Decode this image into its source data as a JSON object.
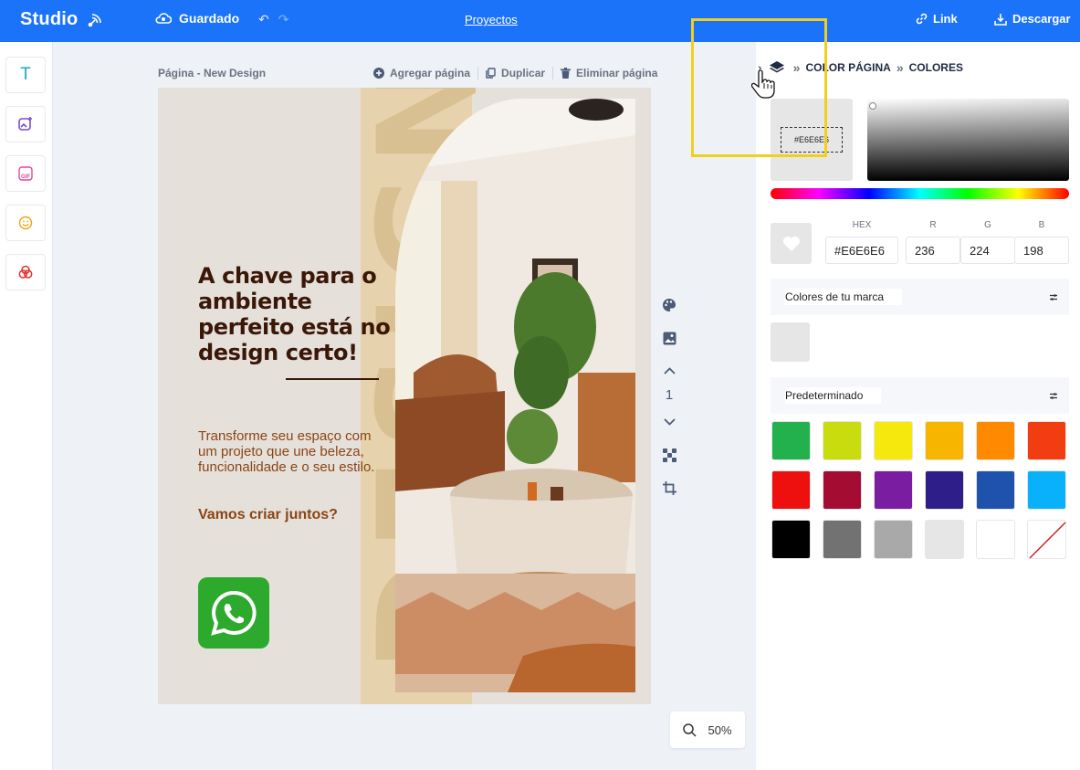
{
  "topbar": {
    "logo": "Studio",
    "saved": "Guardado",
    "projects": "Proyectos",
    "link": "Link",
    "download": "Descargar"
  },
  "left_tools": [
    {
      "name": "text-tool",
      "icon": "T",
      "color": "#1fa6c9"
    },
    {
      "name": "image-tool",
      "icon": "image-plus-icon",
      "color": "#7a4dd1"
    },
    {
      "name": "gif-tool",
      "icon": "gif-icon",
      "color": "#e8449c"
    },
    {
      "name": "emoji-tool",
      "icon": "emoji-icon",
      "color": "#e6a817"
    },
    {
      "name": "shapes-tool",
      "icon": "circles-icon",
      "color": "#e0342b"
    }
  ],
  "page": {
    "title": "Página - New Design",
    "add_page": "Agregar página",
    "duplicate": "Duplicar",
    "delete_page": "Eliminar página",
    "number": "1",
    "zoom": "50%"
  },
  "design": {
    "headline": "A chave para o ambiente perfeito está no design certo!",
    "body": "Transforme seu espaço com um projeto que une beleza, funcionalidade e o seu estilo.",
    "cta": "Vamos criar juntos?",
    "vertical_word": "DESIGN"
  },
  "panel": {
    "breadcrumb": [
      "COLOR PÁGINA",
      "COLORES"
    ],
    "selected_hex_label": "#E6E6E6",
    "hex_label": "HEX",
    "r_label": "R",
    "g_label": "G",
    "b_label": "B",
    "hex_value": "#E6E6E6",
    "r_value": "236",
    "g_value": "224",
    "b_value": "198",
    "brand_colors_title": "Colores de tu marca",
    "brand_colors": [
      "#e6e6e6"
    ],
    "default_title": "Predeterminado",
    "default_colors": [
      "#22b14c",
      "#c8dc0e",
      "#f4e80c",
      "#f7b500",
      "#ff8a00",
      "#f23d11",
      "#ee0f0f",
      "#a50c32",
      "#7b1da0",
      "#2e1e8a",
      "#1f52ad",
      "#09b1fb",
      "#000000",
      "#727272",
      "#a9a9a9",
      "#e6e6e6",
      "#ffffff",
      "none"
    ]
  }
}
